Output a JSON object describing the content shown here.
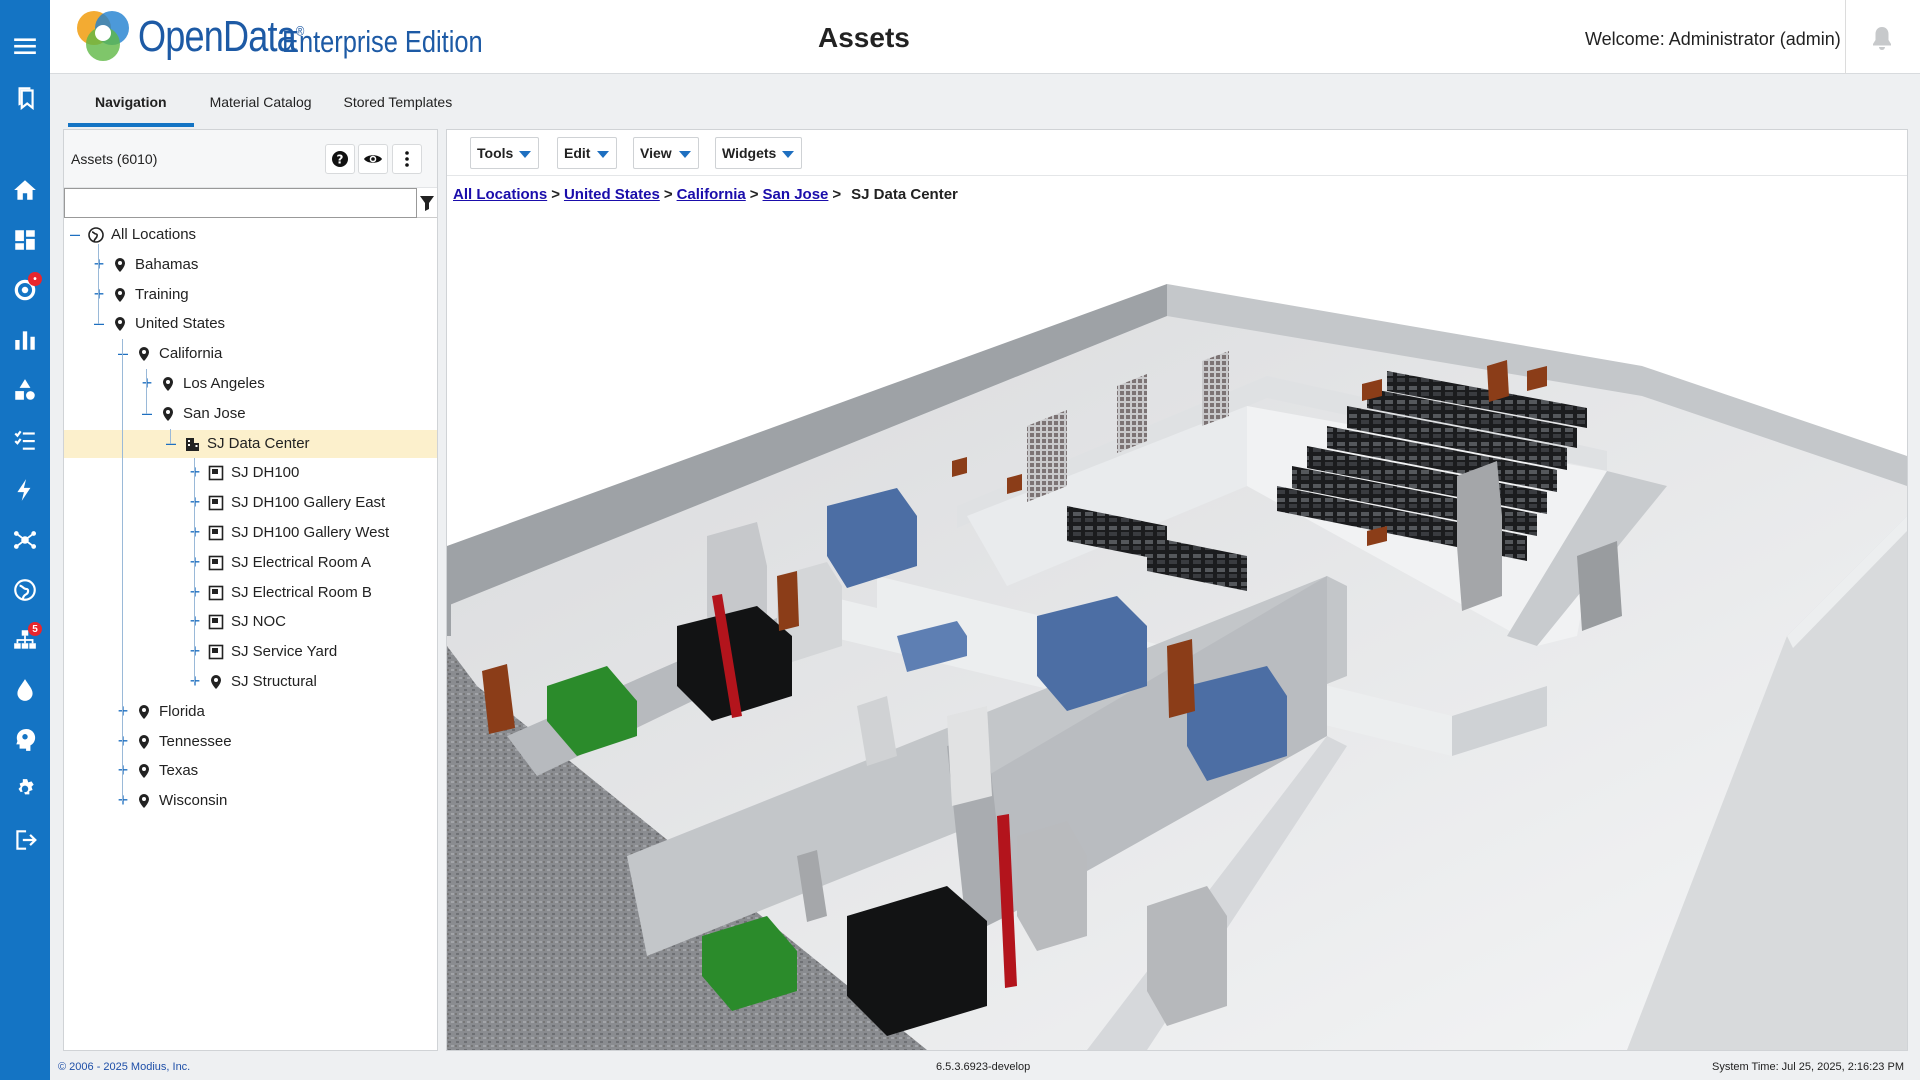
{
  "header": {
    "logo_text": "OpenData",
    "logo_mark": "®",
    "edition": "Enterprise Edition",
    "page_title": "Assets",
    "welcome": "Welcome: Administrator (admin)"
  },
  "rail": {
    "icons": [
      "menu-icon",
      "bookmarks-icon",
      "home-icon",
      "dashboard-icon",
      "alerts-gear-icon",
      "bar-chart-icon",
      "shapes-icon",
      "checklist-icon",
      "power-icon",
      "network-icon",
      "globe-icon",
      "topology-icon",
      "water-drop-icon",
      "head-gear-icon",
      "settings-icon",
      "logout-icon"
    ],
    "alerts_badge": "•",
    "topology_badge": "5"
  },
  "tabs": [
    "Navigation",
    "Material Catalog",
    "Stored Templates"
  ],
  "panel": {
    "title": "Assets (6010)",
    "search_value": ""
  },
  "tree": [
    {
      "label": "All Locations",
      "icon": "globe"
    },
    {
      "label": "Bahamas",
      "icon": "pin"
    },
    {
      "label": "Training",
      "icon": "pin"
    },
    {
      "label": "United States",
      "icon": "pin"
    },
    {
      "label": "California",
      "icon": "pin"
    },
    {
      "label": "Los Angeles",
      "icon": "pin"
    },
    {
      "label": "San Jose",
      "icon": "pin"
    },
    {
      "label": "SJ Data Center",
      "icon": "building"
    },
    {
      "label": "SJ DH100",
      "icon": "room"
    },
    {
      "label": "SJ DH100 Gallery East",
      "icon": "room"
    },
    {
      "label": "SJ DH100 Gallery West",
      "icon": "room"
    },
    {
      "label": "SJ Electrical Room A",
      "icon": "room"
    },
    {
      "label": "SJ Electrical Room B",
      "icon": "room"
    },
    {
      "label": "SJ NOC",
      "icon": "room"
    },
    {
      "label": "SJ Service Yard",
      "icon": "room"
    },
    {
      "label": "SJ Structural",
      "icon": "pin"
    },
    {
      "label": "Florida",
      "icon": "pin"
    },
    {
      "label": "Tennessee",
      "icon": "pin"
    },
    {
      "label": "Texas",
      "icon": "pin"
    },
    {
      "label": "Wisconsin",
      "icon": "pin"
    }
  ],
  "toolbar": {
    "tools": "Tools",
    "edit": "Edit",
    "view": "View",
    "widgets": "Widgets"
  },
  "breadcrumb": {
    "links": [
      "All Locations",
      "United States",
      "California",
      "San Jose"
    ],
    "separator": ">",
    "current": "SJ Data Center"
  },
  "footer": {
    "copyright": "© 2006 - 2025 Modius, Inc.",
    "version": "6.5.3.6923-develop",
    "system_time": "System Time: Jul 25, 2025, 2:16:23 PM"
  }
}
